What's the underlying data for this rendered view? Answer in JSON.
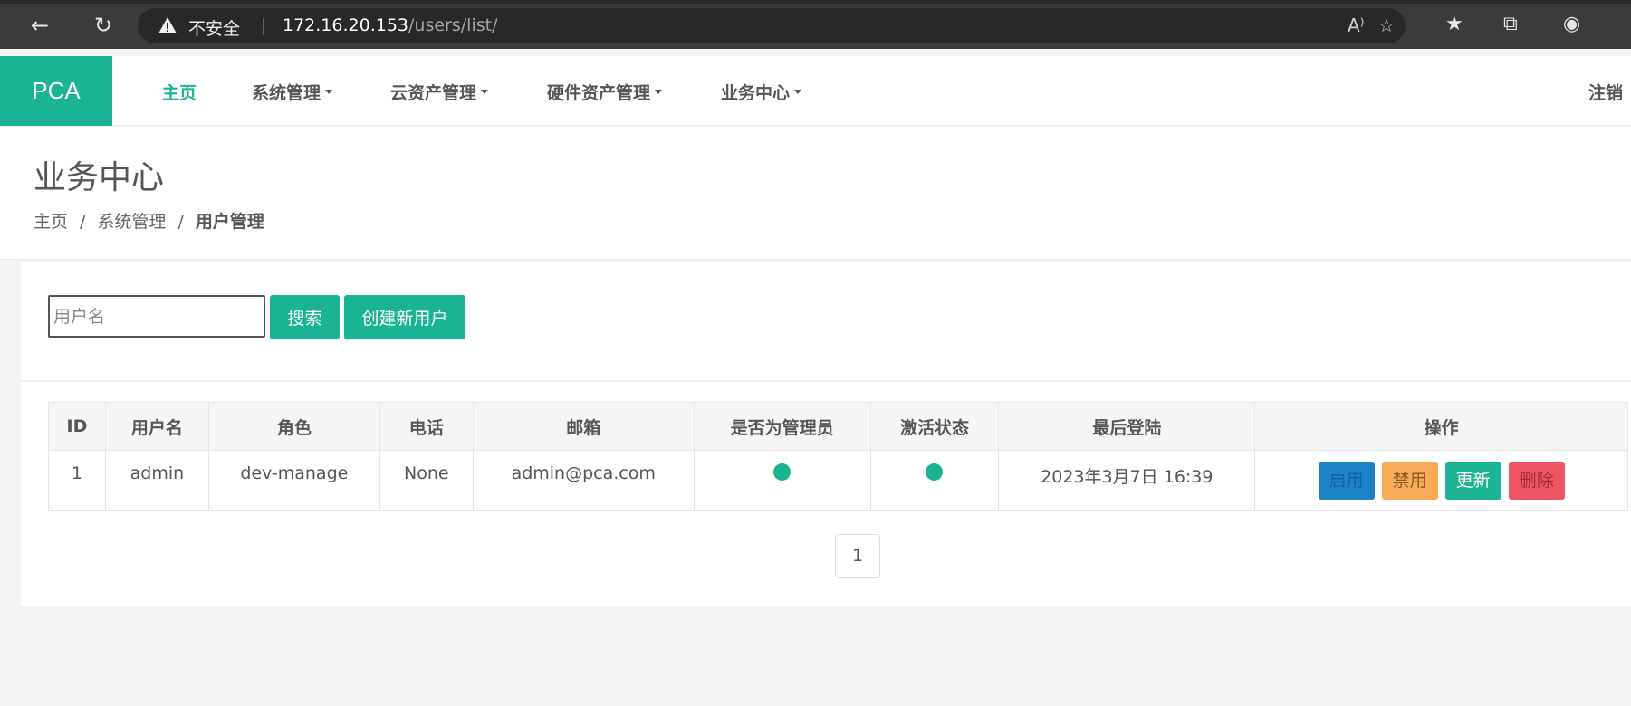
{
  "browser": {
    "security_label": "不安全",
    "separator": "|",
    "url_host": "172.16.20.153",
    "url_path": "/users/list/",
    "read_aloud_glyph": "A⁾"
  },
  "nav": {
    "brand": "PCA",
    "items": [
      {
        "label": "主页"
      },
      {
        "label": "系统管理"
      },
      {
        "label": "云资产管理"
      },
      {
        "label": "硬件资产管理"
      },
      {
        "label": "业务中心"
      }
    ],
    "logout": "注销"
  },
  "heading": {
    "title": "业务中心",
    "breadcrumb": [
      "主页",
      "系统管理",
      "用户管理"
    ],
    "slash": "/"
  },
  "search": {
    "placeholder": "用户名",
    "search_label": "搜索",
    "create_label": "创建新用户"
  },
  "table": {
    "headers": [
      "ID",
      "用户名",
      "角色",
      "电话",
      "邮箱",
      "是否为管理员",
      "激活状态",
      "最后登陆",
      "操作"
    ],
    "rows": [
      {
        "id": "1",
        "username": "admin",
        "role": "dev-manage",
        "phone": "None",
        "email": "admin@pca.com",
        "is_admin": true,
        "active": true,
        "last_login": "2023年3月7日 16:39",
        "actions": [
          "启用",
          "禁用",
          "更新",
          "删除"
        ]
      }
    ]
  },
  "pagination": {
    "current": "1"
  },
  "colors": {
    "accent": "#1ab394",
    "primary": "#1c84c6",
    "warning": "#f8ac59",
    "danger": "#ed5565"
  }
}
